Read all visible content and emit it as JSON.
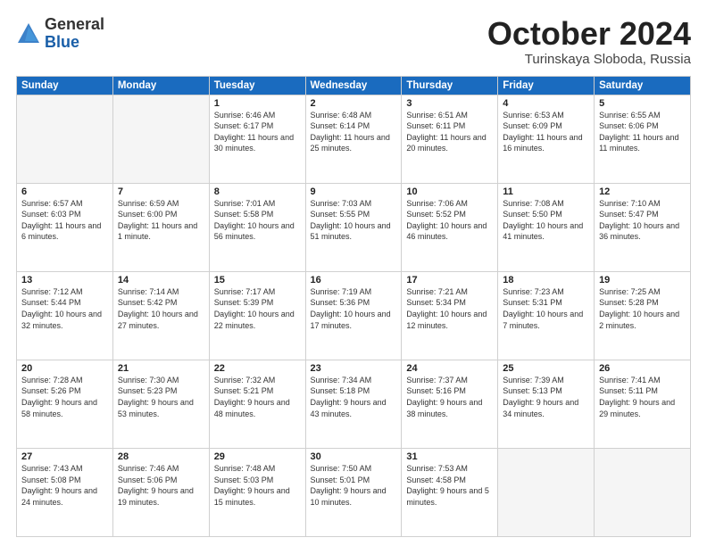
{
  "header": {
    "logo_general": "General",
    "logo_blue": "Blue",
    "month_title": "October 2024",
    "location": "Turinskaya Sloboda, Russia"
  },
  "weekdays": [
    "Sunday",
    "Monday",
    "Tuesday",
    "Wednesday",
    "Thursday",
    "Friday",
    "Saturday"
  ],
  "weeks": [
    [
      {
        "day": "",
        "empty": true
      },
      {
        "day": "",
        "empty": true
      },
      {
        "day": "1",
        "sunrise": "6:46 AM",
        "sunset": "6:17 PM",
        "daylight": "11 hours and 30 minutes."
      },
      {
        "day": "2",
        "sunrise": "6:48 AM",
        "sunset": "6:14 PM",
        "daylight": "11 hours and 25 minutes."
      },
      {
        "day": "3",
        "sunrise": "6:51 AM",
        "sunset": "6:11 PM",
        "daylight": "11 hours and 20 minutes."
      },
      {
        "day": "4",
        "sunrise": "6:53 AM",
        "sunset": "6:09 PM",
        "daylight": "11 hours and 16 minutes."
      },
      {
        "day": "5",
        "sunrise": "6:55 AM",
        "sunset": "6:06 PM",
        "daylight": "11 hours and 11 minutes."
      }
    ],
    [
      {
        "day": "6",
        "sunrise": "6:57 AM",
        "sunset": "6:03 PM",
        "daylight": "11 hours and 6 minutes."
      },
      {
        "day": "7",
        "sunrise": "6:59 AM",
        "sunset": "6:00 PM",
        "daylight": "11 hours and 1 minute."
      },
      {
        "day": "8",
        "sunrise": "7:01 AM",
        "sunset": "5:58 PM",
        "daylight": "10 hours and 56 minutes."
      },
      {
        "day": "9",
        "sunrise": "7:03 AM",
        "sunset": "5:55 PM",
        "daylight": "10 hours and 51 minutes."
      },
      {
        "day": "10",
        "sunrise": "7:06 AM",
        "sunset": "5:52 PM",
        "daylight": "10 hours and 46 minutes."
      },
      {
        "day": "11",
        "sunrise": "7:08 AM",
        "sunset": "5:50 PM",
        "daylight": "10 hours and 41 minutes."
      },
      {
        "day": "12",
        "sunrise": "7:10 AM",
        "sunset": "5:47 PM",
        "daylight": "10 hours and 36 minutes."
      }
    ],
    [
      {
        "day": "13",
        "sunrise": "7:12 AM",
        "sunset": "5:44 PM",
        "daylight": "10 hours and 32 minutes."
      },
      {
        "day": "14",
        "sunrise": "7:14 AM",
        "sunset": "5:42 PM",
        "daylight": "10 hours and 27 minutes."
      },
      {
        "day": "15",
        "sunrise": "7:17 AM",
        "sunset": "5:39 PM",
        "daylight": "10 hours and 22 minutes."
      },
      {
        "day": "16",
        "sunrise": "7:19 AM",
        "sunset": "5:36 PM",
        "daylight": "10 hours and 17 minutes."
      },
      {
        "day": "17",
        "sunrise": "7:21 AM",
        "sunset": "5:34 PM",
        "daylight": "10 hours and 12 minutes."
      },
      {
        "day": "18",
        "sunrise": "7:23 AM",
        "sunset": "5:31 PM",
        "daylight": "10 hours and 7 minutes."
      },
      {
        "day": "19",
        "sunrise": "7:25 AM",
        "sunset": "5:28 PM",
        "daylight": "10 hours and 2 minutes."
      }
    ],
    [
      {
        "day": "20",
        "sunrise": "7:28 AM",
        "sunset": "5:26 PM",
        "daylight": "9 hours and 58 minutes."
      },
      {
        "day": "21",
        "sunrise": "7:30 AM",
        "sunset": "5:23 PM",
        "daylight": "9 hours and 53 minutes."
      },
      {
        "day": "22",
        "sunrise": "7:32 AM",
        "sunset": "5:21 PM",
        "daylight": "9 hours and 48 minutes."
      },
      {
        "day": "23",
        "sunrise": "7:34 AM",
        "sunset": "5:18 PM",
        "daylight": "9 hours and 43 minutes."
      },
      {
        "day": "24",
        "sunrise": "7:37 AM",
        "sunset": "5:16 PM",
        "daylight": "9 hours and 38 minutes."
      },
      {
        "day": "25",
        "sunrise": "7:39 AM",
        "sunset": "5:13 PM",
        "daylight": "9 hours and 34 minutes."
      },
      {
        "day": "26",
        "sunrise": "7:41 AM",
        "sunset": "5:11 PM",
        "daylight": "9 hours and 29 minutes."
      }
    ],
    [
      {
        "day": "27",
        "sunrise": "7:43 AM",
        "sunset": "5:08 PM",
        "daylight": "9 hours and 24 minutes."
      },
      {
        "day": "28",
        "sunrise": "7:46 AM",
        "sunset": "5:06 PM",
        "daylight": "9 hours and 19 minutes."
      },
      {
        "day": "29",
        "sunrise": "7:48 AM",
        "sunset": "5:03 PM",
        "daylight": "9 hours and 15 minutes."
      },
      {
        "day": "30",
        "sunrise": "7:50 AM",
        "sunset": "5:01 PM",
        "daylight": "9 hours and 10 minutes."
      },
      {
        "day": "31",
        "sunrise": "7:53 AM",
        "sunset": "4:58 PM",
        "daylight": "9 hours and 5 minutes."
      },
      {
        "day": "",
        "empty": true
      },
      {
        "day": "",
        "empty": true
      }
    ]
  ],
  "labels": {
    "sunrise": "Sunrise:",
    "sunset": "Sunset:",
    "daylight": "Daylight:"
  }
}
